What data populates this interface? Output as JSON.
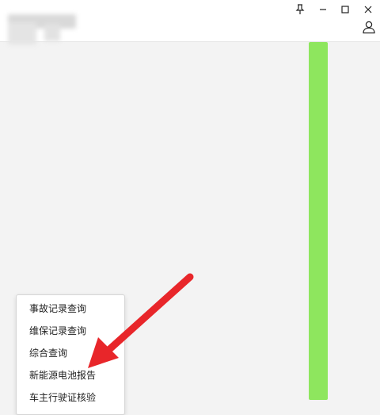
{
  "window": {
    "controls": {
      "pin_icon": "pin-icon",
      "minimize_icon": "minimize-icon",
      "maximize_icon": "maximize-icon",
      "close_icon": "close-icon"
    },
    "user_icon": "user-icon"
  },
  "context_menu": {
    "items": [
      {
        "label": "事故记录查询"
      },
      {
        "label": "维保记录查询"
      },
      {
        "label": "综合查询"
      },
      {
        "label": "新能源电池报告"
      },
      {
        "label": "车主行驶证核验"
      }
    ]
  },
  "colors": {
    "green_bar": "#8ee65e",
    "arrow": "#e8262a"
  }
}
